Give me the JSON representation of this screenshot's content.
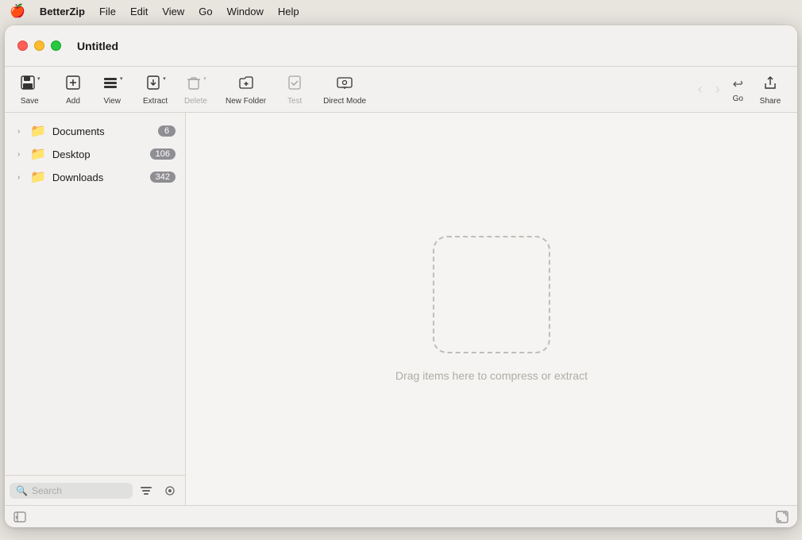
{
  "menubar": {
    "apple_icon": "🍎",
    "items": [
      {
        "label": "BetterZip",
        "active": true
      },
      {
        "label": "File"
      },
      {
        "label": "Edit"
      },
      {
        "label": "View"
      },
      {
        "label": "Go"
      },
      {
        "label": "Window"
      },
      {
        "label": "Help"
      }
    ]
  },
  "window": {
    "title": "Untitled",
    "traffic_lights": {
      "close": "close",
      "minimize": "minimize",
      "maximize": "maximize"
    }
  },
  "toolbar": {
    "items": [
      {
        "id": "save",
        "label": "Save",
        "icon": "⬛",
        "has_arrow": true,
        "disabled": false
      },
      {
        "id": "add",
        "label": "Add",
        "icon": "✚",
        "has_arrow": false,
        "disabled": false
      },
      {
        "id": "view",
        "label": "View",
        "icon": "⊞",
        "has_arrow": true,
        "disabled": false
      },
      {
        "id": "extract",
        "label": "Extract",
        "icon": "📤",
        "has_arrow": true,
        "disabled": false
      },
      {
        "id": "delete",
        "label": "Delete",
        "icon": "🗑",
        "has_arrow": true,
        "disabled": false
      },
      {
        "id": "new-folder",
        "label": "New Folder",
        "icon": "📁",
        "has_arrow": false,
        "disabled": false
      },
      {
        "id": "test",
        "label": "Test",
        "icon": "✓",
        "has_arrow": false,
        "disabled": false
      },
      {
        "id": "direct-mode",
        "label": "Direct Mode",
        "icon": "📺",
        "has_arrow": false,
        "disabled": false
      }
    ],
    "nav": {
      "back_label": "‹",
      "forward_label": "›",
      "go_label": "Go"
    },
    "share_label": "Share"
  },
  "sidebar": {
    "items": [
      {
        "name": "Documents",
        "badge": "6",
        "icon": "📁"
      },
      {
        "name": "Desktop",
        "badge": "106",
        "icon": "📁"
      },
      {
        "name": "Downloads",
        "badge": "342",
        "icon": "📁"
      }
    ],
    "search_placeholder": "Search"
  },
  "drop_area": {
    "hint": "Drag items here to compress or extract"
  }
}
